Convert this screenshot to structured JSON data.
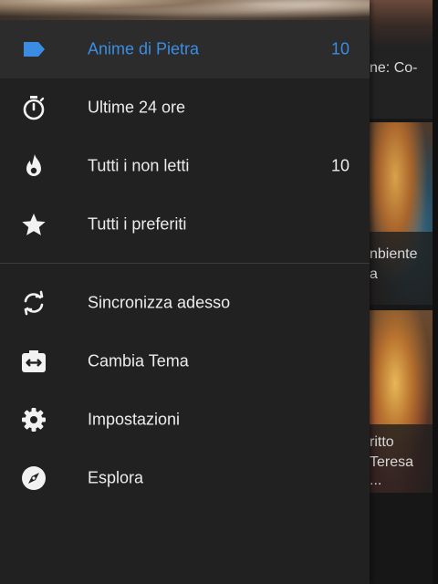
{
  "background": {
    "cards": [
      {
        "text_lines": [
          "ne: Co-"
        ]
      },
      {
        "text_lines": [
          "nbiente",
          "a"
        ]
      },
      {
        "text_lines": [
          "ritto",
          "Teresa",
          "..."
        ]
      }
    ]
  },
  "drawer": {
    "feeds": [
      {
        "label": "Anime di Pietra",
        "count": "10",
        "icon": "label-icon",
        "selected": true
      },
      {
        "label": "Ultime 24 ore",
        "count": "",
        "icon": "stopwatch-icon"
      },
      {
        "label": "Tutti i non letti",
        "count": "10",
        "icon": "flame-icon"
      },
      {
        "label": "Tutti i preferiti",
        "count": "",
        "icon": "star-icon"
      }
    ],
    "actions": [
      {
        "label": "Sincronizza adesso",
        "icon": "sync-icon"
      },
      {
        "label": "Cambia Tema",
        "icon": "switch-theme-icon"
      },
      {
        "label": "Impostazioni",
        "icon": "settings-gear-icon"
      },
      {
        "label": "Esplora",
        "icon": "compass-icon"
      }
    ]
  },
  "colors": {
    "accent": "#3b8de3",
    "drawer_bg": "#212121",
    "selected_bg": "#2c2c2c",
    "text": "#ececec"
  }
}
